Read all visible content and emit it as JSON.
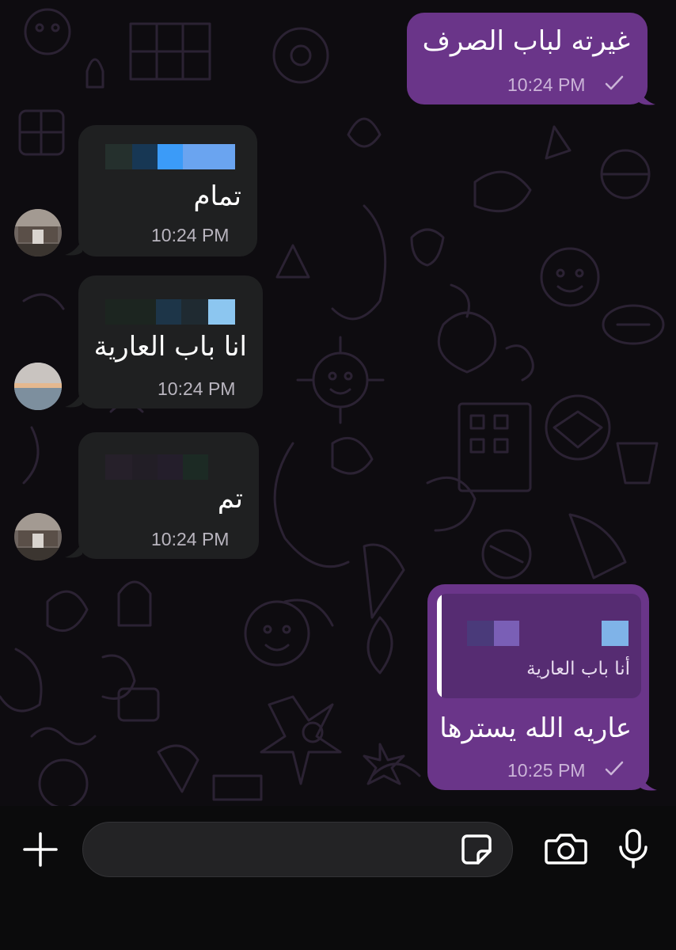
{
  "messages": [
    {
      "direction": "outgoing",
      "text": "غيرته لباب الصرف",
      "time": "10:24 PM",
      "status": "sent-check"
    },
    {
      "direction": "incoming",
      "text": "تمام",
      "time": "10:24 PM",
      "sender": "redacted"
    },
    {
      "direction": "incoming",
      "text": "انا باب العارية",
      "time": "10:24 PM",
      "sender": "redacted"
    },
    {
      "direction": "incoming",
      "text": "تم",
      "time": "10:24 PM",
      "sender": "redacted"
    },
    {
      "direction": "outgoing",
      "reply_to": {
        "sender": "redacted",
        "text": "أنا باب العارية"
      },
      "text": "عاريه الله يسترها",
      "time": "10:25 PM",
      "status": "sent-check"
    }
  ],
  "composer": {
    "placeholder": "",
    "icons": [
      "plus-icon",
      "sticker-icon",
      "camera-icon",
      "microphone-icon"
    ]
  },
  "colors": {
    "outgoing_bubble": "#6a3589",
    "incoming_bubble": "#1f2021",
    "chat_background": "#0e0c10"
  }
}
